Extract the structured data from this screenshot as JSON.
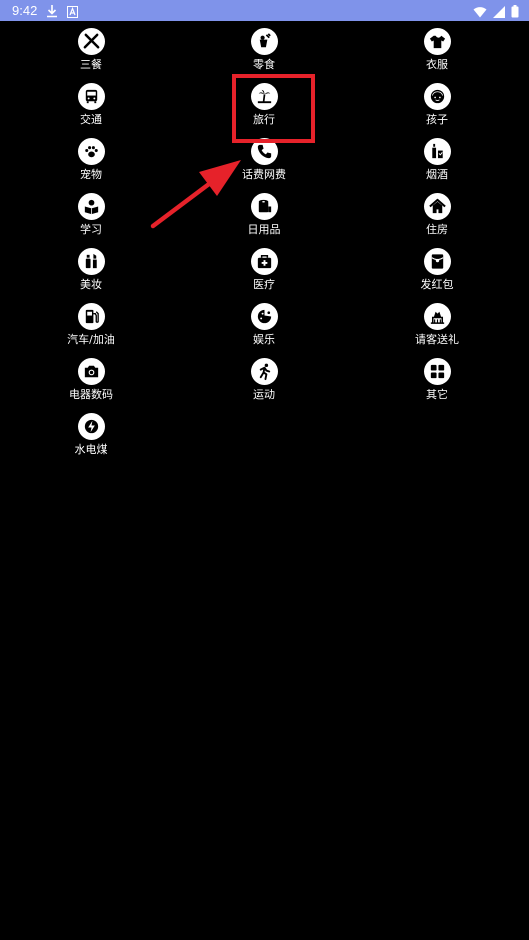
{
  "status_bar": {
    "time": "9:42",
    "left_icons": [
      "download-icon",
      "text-a-icon"
    ],
    "right_icons": [
      "wifi-icon",
      "signal-icon",
      "battery-icon"
    ],
    "color": "#7f93ea"
  },
  "categories": [
    {
      "label": "三餐",
      "icon": "fork-knife-icon"
    },
    {
      "label": "零食",
      "icon": "snack-icon"
    },
    {
      "label": "衣服",
      "icon": "shirt-icon"
    },
    {
      "label": "交通",
      "icon": "bus-icon"
    },
    {
      "label": "旅行",
      "icon": "palm-tree-icon"
    },
    {
      "label": "孩子",
      "icon": "child-icon"
    },
    {
      "label": "宠物",
      "icon": "paw-icon"
    },
    {
      "label": "话费网费",
      "icon": "phone-icon"
    },
    {
      "label": "烟酒",
      "icon": "bottle-icon"
    },
    {
      "label": "学习",
      "icon": "reading-icon"
    },
    {
      "label": "日用品",
      "icon": "toilet-paper-icon"
    },
    {
      "label": "住房",
      "icon": "house-icon"
    },
    {
      "label": "美妆",
      "icon": "cosmetics-icon"
    },
    {
      "label": "医疗",
      "icon": "medical-kit-icon"
    },
    {
      "label": "发红包",
      "icon": "red-envelope-icon"
    },
    {
      "label": "汽车/加油",
      "icon": "fuel-icon"
    },
    {
      "label": "娱乐",
      "icon": "game-icon"
    },
    {
      "label": "请客送礼",
      "icon": "gift-icon"
    },
    {
      "label": "电器数码",
      "icon": "camera-icon"
    },
    {
      "label": "运动",
      "icon": "running-icon"
    },
    {
      "label": "其它",
      "icon": "grid-icon"
    },
    {
      "label": "水电煤",
      "icon": "lightning-icon"
    }
  ],
  "annotation": {
    "highlighted_category": "旅行",
    "highlight_color": "#e6222a"
  }
}
